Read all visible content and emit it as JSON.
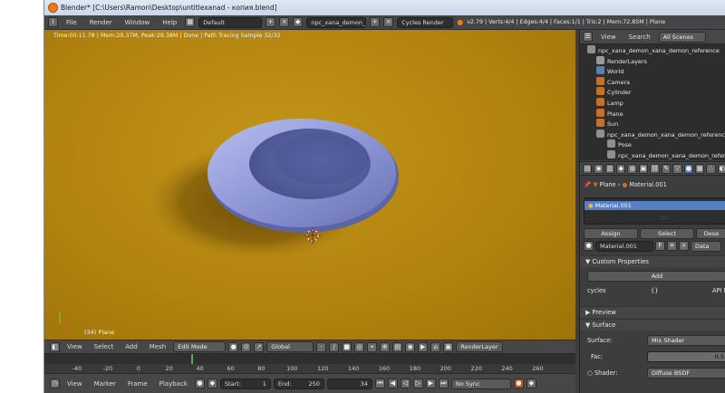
{
  "window": {
    "title": "Blender* [C:\\Users\\Ramon\\Desktop\\untitlexanad - копия.blend]"
  },
  "menubar": {
    "items": [
      "File",
      "Render",
      "Window",
      "Help"
    ],
    "layout": "Default",
    "scene": "npc_xana_demon_x...",
    "engine": "Cycles Render",
    "stats": "v2.79 | Verts:4/4 | Edges:4/4 | Faces:1/1 | Tris:2 | Mem:72.85M | Plane"
  },
  "viewport": {
    "render_info": "Time:00:11.78 | Mem:29.37M, Peak:29.38M | Done | Path Tracing Sample 32/32",
    "object_label": "(34) Plane",
    "background_color": "#b98b14"
  },
  "header3d": {
    "items": [
      "View",
      "Select",
      "Add",
      "Mesh"
    ],
    "mode": "Edit Mode",
    "orientation": "Global",
    "render_layer": "RenderLayer"
  },
  "timeline": {
    "ticks": [
      "-40",
      "-20",
      "0",
      "20",
      "40",
      "60",
      "80",
      "100",
      "120",
      "140",
      "160",
      "180",
      "200",
      "220",
      "240",
      "260"
    ],
    "current_frame": 34
  },
  "timeline_header": {
    "items": [
      "View",
      "Marker",
      "Frame",
      "Playback"
    ],
    "start": "Start:",
    "start_value": "1",
    "end": "End:",
    "end_value": "250",
    "current": "34",
    "sync": "No Sync"
  },
  "outliner": {
    "head": {
      "view": "View",
      "search": "Search",
      "scenes": "All Scenes"
    },
    "rows": [
      {
        "label": "npc_xana_demon_xana_demon_reference",
        "color": "#8f8f8f"
      },
      {
        "label": "RenderLayers",
        "color": "#9a9a9a"
      },
      {
        "label": "World",
        "color": "#5a7fa8"
      },
      {
        "label": "Camera",
        "color": "#c4712a"
      },
      {
        "label": "Cylinder",
        "color": "#c4712a"
      },
      {
        "label": "Lamp",
        "color": "#c4712a"
      },
      {
        "label": "Plane",
        "color": "#c4712a"
      },
      {
        "label": "Sun",
        "color": "#c4712a"
      },
      {
        "label": "npc_xana_demon_xana_demon_reference_s",
        "color": "#8f8f8f"
      },
      {
        "label": "Pose",
        "color": "#8f8f8f"
      },
      {
        "label": "npc_xana_demon_xana_demon_reference",
        "color": "#8f8f8f"
      }
    ]
  },
  "properties": {
    "breadcrumb_object": "Plane",
    "breadcrumb_material": "Material.001",
    "slot": "Material.001",
    "assign": "Assign",
    "select": "Select",
    "deselect": "Dese",
    "material_field": "Material.001",
    "f_label": "F",
    "data_label": "Data",
    "custom_properties": "Custom Properties",
    "add": "Add",
    "cycles": "cycles",
    "cycles_value": "{}",
    "api": "API D",
    "preview": "Preview",
    "surface": "Surface",
    "surface_label": "Surface:",
    "surface_value": "Mix Shader",
    "fac_label": "Fac:",
    "fac_value": "0.5",
    "shader_label": "Shader:",
    "shader_value": "Diffuse BSDF"
  }
}
